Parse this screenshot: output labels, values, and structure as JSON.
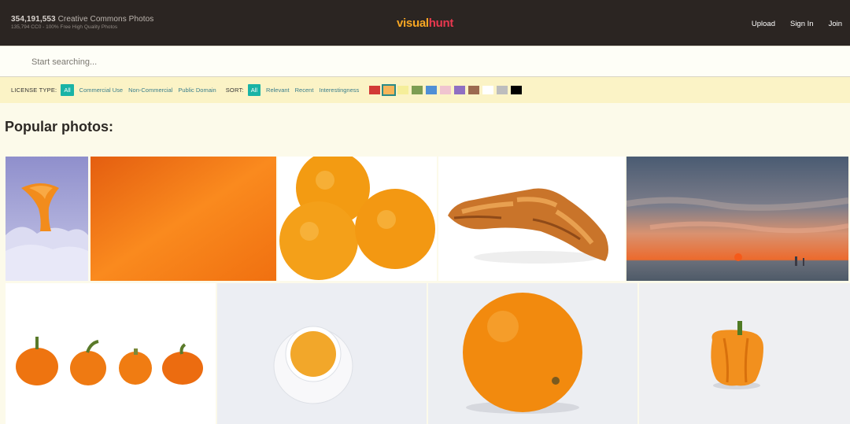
{
  "header": {
    "stats_count": "354,191,553",
    "stats_label": "Creative Commons Photos",
    "stats_sub": "135,794 CC0 - 100% Free High Quality Photos",
    "logo_part1": "visual",
    "logo_part2": "hunt",
    "nav": [
      "Upload",
      "Sign In",
      "Join"
    ]
  },
  "search": {
    "placeholder": "Start searching..."
  },
  "filters": {
    "license_label": "LICENSE TYPE:",
    "license_options": [
      "All",
      "Commercial Use",
      "Non-Commercial",
      "Public Domain"
    ],
    "sort_label": "SORT:",
    "sort_options": [
      "All",
      "Relevant",
      "Recent",
      "Interestingness"
    ],
    "colors": [
      "#d23a36",
      "#f6b55a",
      "#f5ee9a",
      "#7d9d52",
      "#4f8fd6",
      "#f0c4cf",
      "#8f6fc2",
      "#9c6a50",
      "#ffffff",
      "#bdbdbd",
      "#000000"
    ],
    "selected_color": "#f6b55a"
  },
  "main": {
    "title": "Popular photos:",
    "photos": [
      {
        "subject": "orange flower in snow"
      },
      {
        "subject": "orange gradient"
      },
      {
        "subject": "three oranges"
      },
      {
        "subject": "croissant"
      },
      {
        "subject": "sunset over sea"
      },
      {
        "subject": "row of pumpkins"
      },
      {
        "subject": "cup of tea"
      },
      {
        "subject": "single orange"
      },
      {
        "subject": "orange bell pepper"
      }
    ]
  }
}
